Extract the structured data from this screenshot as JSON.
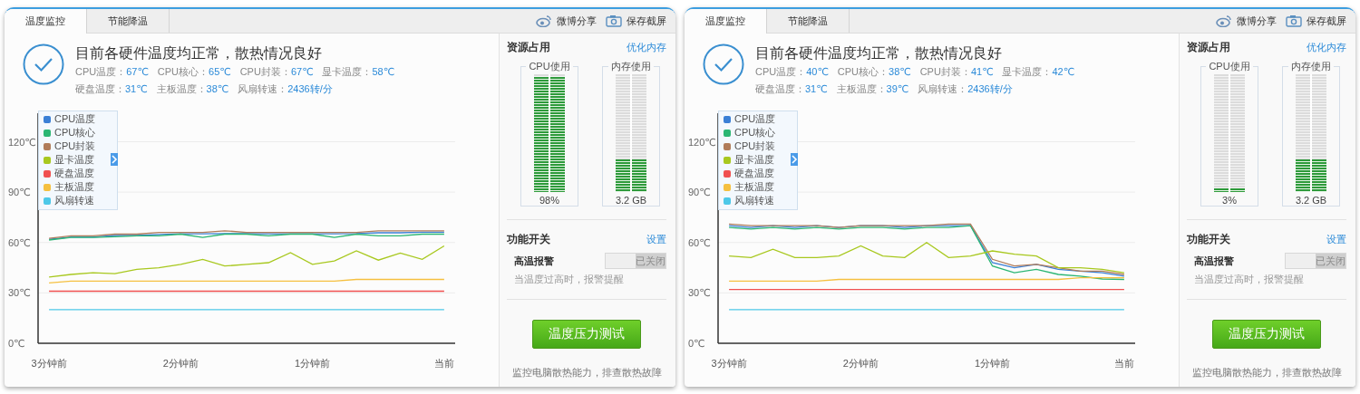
{
  "windows": [
    {
      "tabs": [
        {
          "label": "温度监控",
          "selected": true
        },
        {
          "label": "节能降温",
          "selected": false
        }
      ],
      "toolbar": [
        {
          "kind": "share",
          "label": "微博分享"
        },
        {
          "kind": "capture",
          "label": "保存截屏"
        }
      ],
      "status": {
        "title": "目前各硬件温度均正常，散热情况良好",
        "reading_rows": [
          [
            {
              "label": "CPU温度：",
              "value": "67℃"
            },
            {
              "label": "CPU核心：",
              "value": "65℃"
            },
            {
              "label": "CPU封装：",
              "value": "67℃"
            },
            {
              "label": "显卡温度：",
              "value": "58℃"
            }
          ],
          [
            {
              "label": "硬盘温度：",
              "value": "31℃"
            },
            {
              "label": "主板温度：",
              "value": "38℃"
            },
            {
              "label": "风扇转速：",
              "value": "2436转/分"
            }
          ]
        ]
      },
      "chart": {
        "chart_data": {
          "type": "line",
          "grid": true,
          "legend": true,
          "categories": [
            "3分钟前",
            null,
            null,
            null,
            null,
            null,
            "2分钟前",
            null,
            null,
            null,
            null,
            null,
            "1分钟前",
            null,
            null,
            null,
            null,
            null,
            "当前"
          ],
          "ylim": [
            0,
            137
          ],
          "yticks": [
            {
              "value": 0,
              "label": "0℃"
            },
            {
              "value": 30,
              "label": "30℃"
            },
            {
              "value": 60,
              "label": "60℃"
            },
            {
              "value": 90,
              "label": "90℃"
            },
            {
              "value": 120,
              "label": "120℃"
            }
          ],
          "series": [
            {
              "name": "CPU温度",
              "color": "#3a7fd5",
              "values": [
                62,
                63.2,
                63.2,
                64.2,
                64.2,
                64.8,
                65.2,
                65.2,
                65.3,
                65.3,
                65.2,
                65.2,
                65.2,
                65.2,
                65.3,
                65.8,
                65.8,
                66.2,
                66.2
              ]
            },
            {
              "name": "CPU核心",
              "color": "#2bb673",
              "values": [
                61.5,
                63,
                63,
                63.5,
                64,
                64,
                65,
                63,
                65,
                65,
                64,
                65,
                65,
                63,
                65,
                64,
                64,
                65,
                65
              ]
            },
            {
              "name": "CPU封装",
              "color": "#b07c5a",
              "values": [
                62.5,
                64,
                64,
                65,
                65,
                66,
                66,
                66,
                67,
                66,
                66,
                66,
                66,
                66,
                66,
                67,
                67,
                67,
                67
              ]
            },
            {
              "name": "显卡温度",
              "color": "#a8c81e",
              "values": [
                39.5,
                41,
                42,
                41.5,
                44,
                45,
                47,
                50,
                46,
                47,
                48,
                54,
                47,
                49,
                55,
                49.5,
                53.7,
                50,
                58
              ]
            },
            {
              "name": "硬盘温度",
              "color": "#f05050",
              "values": [
                31,
                31,
                31,
                31,
                31,
                31,
                31,
                31,
                31,
                31,
                31,
                31,
                31,
                31,
                31,
                31,
                31,
                31,
                31
              ]
            },
            {
              "name": "主板温度",
              "color": "#f5c040",
              "values": [
                36,
                37,
                37,
                37,
                37,
                37,
                37,
                37,
                37,
                37,
                37,
                37,
                37,
                37,
                38,
                38,
                38,
                38,
                38
              ]
            },
            {
              "name": "风扇转速",
              "color": "#4cc8e8",
              "values": [
                20,
                20,
                20,
                20,
                20,
                20,
                20,
                20,
                20,
                20,
                20,
                20,
                20,
                20,
                20,
                20,
                20,
                20,
                20
              ]
            }
          ]
        }
      },
      "resources": {
        "title": "资源占用",
        "link": "优化内存",
        "meters": [
          {
            "label": "CPU使用",
            "level": 0.98,
            "reading": "98%"
          },
          {
            "label": "内存使用",
            "level": 0.28,
            "reading": "3.2 GB"
          }
        ]
      },
      "switches": {
        "title": "功能开关",
        "link": "设置",
        "items": [
          {
            "label": "高温报警",
            "on": false,
            "state_text": "已关闭",
            "hint": "当温度过高时，报警提醒"
          }
        ]
      },
      "test_button": "温度压力测试",
      "footer_note": "监控电脑散热能力，排查散热故障"
    },
    {
      "tabs": [
        {
          "label": "温度监控",
          "selected": true
        },
        {
          "label": "节能降温",
          "selected": false
        }
      ],
      "toolbar": [
        {
          "kind": "share",
          "label": "微博分享"
        },
        {
          "kind": "capture",
          "label": "保存截屏"
        }
      ],
      "status": {
        "title": "目前各硬件温度均正常，散热情况良好",
        "reading_rows": [
          [
            {
              "label": "CPU温度：",
              "value": "40℃"
            },
            {
              "label": "CPU核心：",
              "value": "38℃"
            },
            {
              "label": "CPU封装：",
              "value": "41℃"
            },
            {
              "label": "显卡温度：",
              "value": "42℃"
            }
          ],
          [
            {
              "label": "硬盘温度：",
              "value": "31℃"
            },
            {
              "label": "主板温度：",
              "value": "39℃"
            },
            {
              "label": "风扇转速：",
              "value": "2436转/分"
            }
          ]
        ]
      },
      "chart": {
        "chart_data": {
          "type": "line",
          "grid": true,
          "legend": true,
          "categories": [
            "3分钟前",
            null,
            null,
            null,
            null,
            null,
            "2分钟前",
            null,
            null,
            null,
            null,
            null,
            "1分钟前",
            null,
            null,
            null,
            null,
            null,
            "当前"
          ],
          "ylim": [
            0,
            137
          ],
          "yticks": [
            {
              "value": 0,
              "label": "0℃"
            },
            {
              "value": 30,
              "label": "30℃"
            },
            {
              "value": 60,
              "label": "60℃"
            },
            {
              "value": 90,
              "label": "90℃"
            },
            {
              "value": 120,
              "label": "120℃"
            }
          ],
          "series": [
            {
              "name": "CPU温度",
              "color": "#3a7fd5",
              "values": [
                70,
                69,
                70,
                69,
                70,
                69,
                70,
                70,
                69,
                70,
                70,
                70,
                48,
                45,
                47,
                44,
                43,
                42,
                40
              ]
            },
            {
              "name": "CPU核心",
              "color": "#2bb673",
              "values": [
                69,
                68,
                69,
                68,
                69,
                68,
                69,
                69,
                68,
                69,
                69,
                70,
                46,
                42,
                44,
                41,
                40,
                38.3,
                38
              ]
            },
            {
              "name": "CPU封装",
              "color": "#b07c5a",
              "values": [
                71,
                70,
                70,
                70,
                70,
                69,
                70,
                70,
                70,
                70,
                71,
                71,
                50,
                46,
                47,
                45,
                43,
                43,
                41
              ]
            },
            {
              "name": "显卡温度",
              "color": "#a8c81e",
              "values": [
                52,
                51,
                56,
                51,
                51,
                52,
                58,
                52,
                51,
                60,
                51,
                52,
                55,
                53,
                52,
                45,
                45,
                44,
                42
              ]
            },
            {
              "name": "硬盘温度",
              "color": "#f05050",
              "values": [
                32,
                32,
                32,
                32,
                32,
                32,
                32,
                32,
                32,
                32,
                32,
                32,
                32,
                32,
                32,
                32,
                32,
                32,
                32
              ]
            },
            {
              "name": "主板温度",
              "color": "#f5c040",
              "values": [
                37,
                37,
                37,
                37,
                37,
                38,
                38,
                38,
                38,
                38,
                38,
                38,
                38,
                38,
                38,
                38,
                39,
                39,
                39
              ]
            },
            {
              "name": "风扇转速",
              "color": "#4cc8e8",
              "values": [
                20,
                20,
                20,
                20,
                20,
                20,
                20,
                20,
                20,
                20,
                20,
                20,
                20,
                20,
                20,
                20,
                20,
                20,
                20
              ]
            }
          ]
        }
      },
      "resources": {
        "title": "资源占用",
        "link": "优化内存",
        "meters": [
          {
            "label": "CPU使用",
            "level": 0.03,
            "reading": "3%"
          },
          {
            "label": "内存使用",
            "level": 0.28,
            "reading": "3.2 GB"
          }
        ]
      },
      "switches": {
        "title": "功能开关",
        "link": "设置",
        "items": [
          {
            "label": "高温报警",
            "on": false,
            "state_text": "已关闭",
            "hint": "当温度过高时，报警提醒"
          }
        ]
      },
      "test_button": "温度压力测试",
      "footer_note": "监控电脑散热能力，排查散热故障"
    }
  ]
}
